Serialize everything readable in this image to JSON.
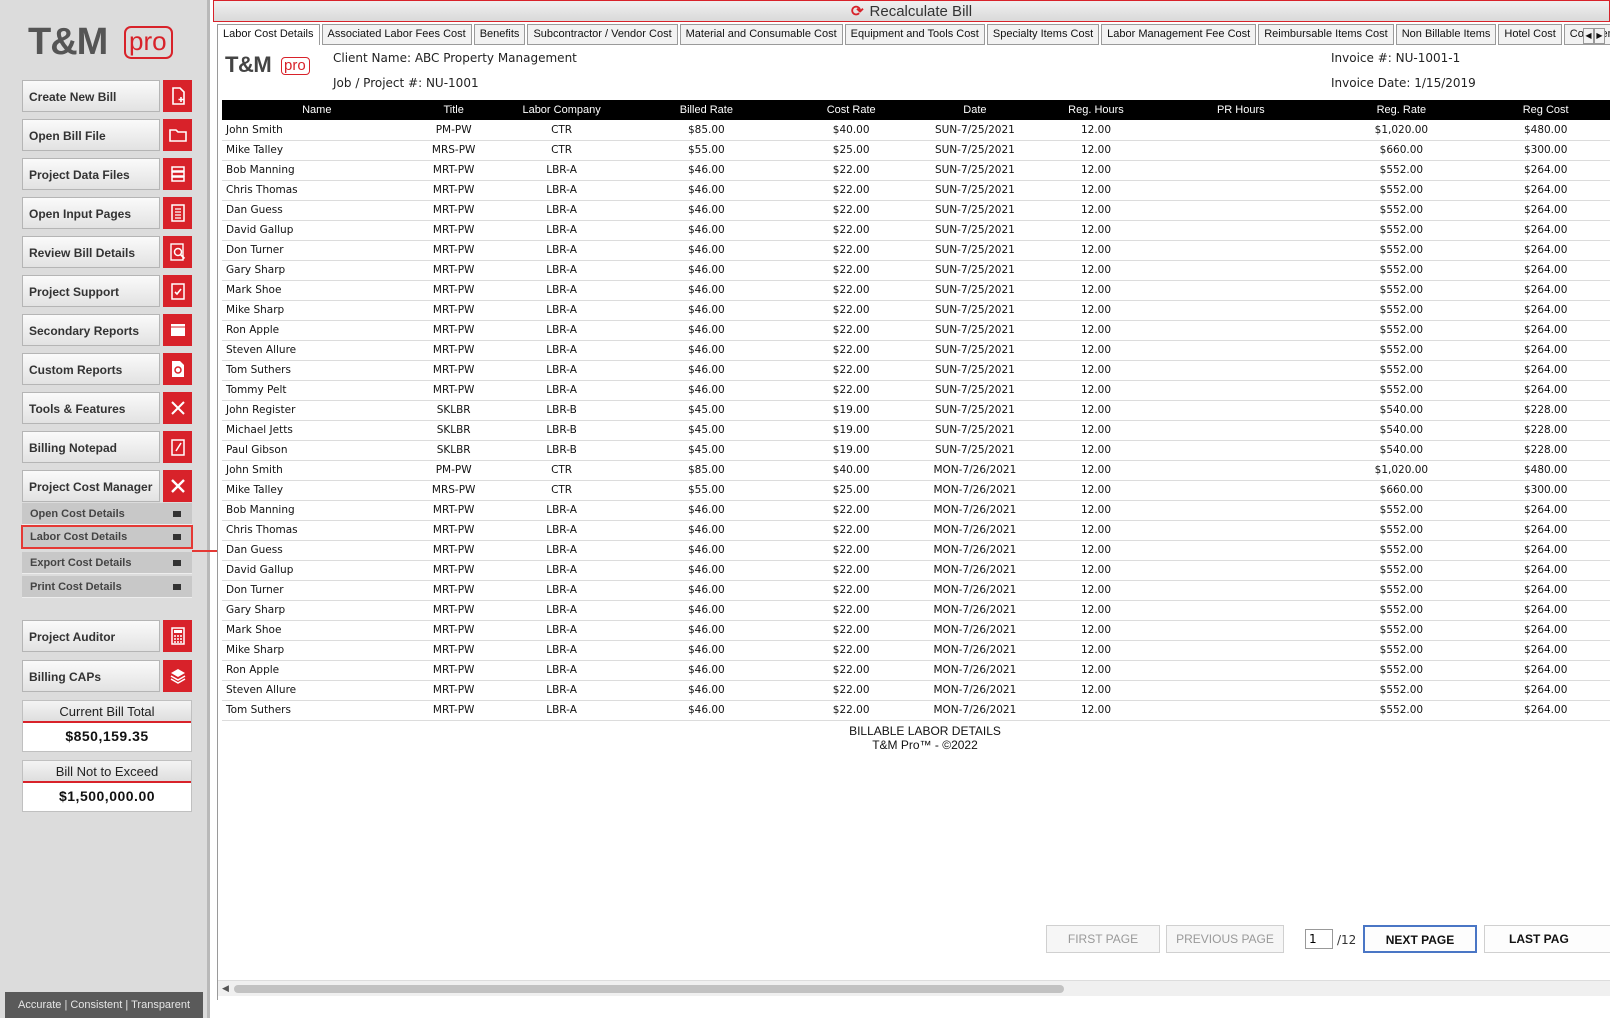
{
  "app": {
    "logo_main": "T&M",
    "logo_sub": "pro",
    "tagline": "Accurate | Consistent | Transparent"
  },
  "sidebar": {
    "buttons": [
      {
        "label": "Create New Bill",
        "icon": "new-file-icon"
      },
      {
        "label": "Open Bill File",
        "icon": "folder-icon"
      },
      {
        "label": "Project Data Files",
        "icon": "list-icon"
      },
      {
        "label": "Open Input Pages",
        "icon": "pages-icon"
      },
      {
        "label": "Review Bill Details",
        "icon": "magnifier-icon"
      },
      {
        "label": "Project Support",
        "icon": "checklist-icon"
      },
      {
        "label": "Secondary Reports",
        "icon": "report-icon"
      },
      {
        "label": "Custom Reports",
        "icon": "gear-doc-icon"
      },
      {
        "label": "Tools & Features",
        "icon": "tools-icon"
      },
      {
        "label": "Billing Notepad",
        "icon": "notepad-icon"
      },
      {
        "label": "Project Cost Manager",
        "icon": "close-icon"
      }
    ],
    "sub_items": [
      {
        "label": "Open Cost Details"
      },
      {
        "label": "Labor Cost Details"
      },
      {
        "label": "Export Cost Details"
      },
      {
        "label": "Print Cost Details"
      }
    ],
    "bottom_buttons": [
      {
        "label": "Project Auditor",
        "icon": "calculator-icon"
      },
      {
        "label": "Billing CAPs",
        "icon": "layers-icon"
      }
    ],
    "current_bill_total": {
      "label": "Current Bill Total",
      "value": "$850,159.35"
    },
    "bill_not_to_exceed": {
      "label": "Bill Not to Exceed",
      "value": "$1,500,000.00"
    }
  },
  "toolbar": {
    "recalculate_label": "Recalculate Bill"
  },
  "tabs": [
    "Labor Cost Details",
    "Associated Labor Fees Cost",
    "Benefits",
    "Subcontractor / Vendor Cost",
    "Material and Consumable Cost",
    "Equipment and Tools Cost",
    "Specialty Items Cost",
    "Labor Management Fee Cost",
    "Reimbursable Items Cost",
    "Non Billable Items",
    "Hotel Cost",
    "Cost Item F"
  ],
  "invoice": {
    "client_name": "Client Name: ABC Property Management",
    "job_project": "Job / Project #: NU-1001",
    "invoice_number": "Invoice #: NU-1001-1",
    "invoice_date": "Invoice Date: 1/15/2019"
  },
  "table": {
    "columns": [
      "Name",
      "Title",
      "Labor Company",
      "Billed Rate",
      "Cost Rate",
      "Date",
      "Reg. Hours",
      "PR Hours",
      "Reg. Rate",
      "Reg Cost"
    ],
    "rows": [
      [
        "John Smith",
        "PM-PW",
        "CTR",
        "$85.00",
        "$40.00",
        "SUN-7/25/2021",
        "12.00",
        "",
        "$1,020.00",
        "$480.00"
      ],
      [
        "Mike Talley",
        "MRS-PW",
        "CTR",
        "$55.00",
        "$25.00",
        "SUN-7/25/2021",
        "12.00",
        "",
        "$660.00",
        "$300.00"
      ],
      [
        "Bob Manning",
        "MRT-PW",
        "LBR-A",
        "$46.00",
        "$22.00",
        "SUN-7/25/2021",
        "12.00",
        "",
        "$552.00",
        "$264.00"
      ],
      [
        "Chris Thomas",
        "MRT-PW",
        "LBR-A",
        "$46.00",
        "$22.00",
        "SUN-7/25/2021",
        "12.00",
        "",
        "$552.00",
        "$264.00"
      ],
      [
        "Dan Guess",
        "MRT-PW",
        "LBR-A",
        "$46.00",
        "$22.00",
        "SUN-7/25/2021",
        "12.00",
        "",
        "$552.00",
        "$264.00"
      ],
      [
        "David Gallup",
        "MRT-PW",
        "LBR-A",
        "$46.00",
        "$22.00",
        "SUN-7/25/2021",
        "12.00",
        "",
        "$552.00",
        "$264.00"
      ],
      [
        "Don Turner",
        "MRT-PW",
        "LBR-A",
        "$46.00",
        "$22.00",
        "SUN-7/25/2021",
        "12.00",
        "",
        "$552.00",
        "$264.00"
      ],
      [
        "Gary Sharp",
        "MRT-PW",
        "LBR-A",
        "$46.00",
        "$22.00",
        "SUN-7/25/2021",
        "12.00",
        "",
        "$552.00",
        "$264.00"
      ],
      [
        "Mark Shoe",
        "MRT-PW",
        "LBR-A",
        "$46.00",
        "$22.00",
        "SUN-7/25/2021",
        "12.00",
        "",
        "$552.00",
        "$264.00"
      ],
      [
        "Mike Sharp",
        "MRT-PW",
        "LBR-A",
        "$46.00",
        "$22.00",
        "SUN-7/25/2021",
        "12.00",
        "",
        "$552.00",
        "$264.00"
      ],
      [
        "Ron Apple",
        "MRT-PW",
        "LBR-A",
        "$46.00",
        "$22.00",
        "SUN-7/25/2021",
        "12.00",
        "",
        "$552.00",
        "$264.00"
      ],
      [
        "Steven Allure",
        "MRT-PW",
        "LBR-A",
        "$46.00",
        "$22.00",
        "SUN-7/25/2021",
        "12.00",
        "",
        "$552.00",
        "$264.00"
      ],
      [
        "Tom Suthers",
        "MRT-PW",
        "LBR-A",
        "$46.00",
        "$22.00",
        "SUN-7/25/2021",
        "12.00",
        "",
        "$552.00",
        "$264.00"
      ],
      [
        "Tommy Pelt",
        "MRT-PW",
        "LBR-A",
        "$46.00",
        "$22.00",
        "SUN-7/25/2021",
        "12.00",
        "",
        "$552.00",
        "$264.00"
      ],
      [
        "John Register",
        "SKLBR",
        "LBR-B",
        "$45.00",
        "$19.00",
        "SUN-7/25/2021",
        "12.00",
        "",
        "$540.00",
        "$228.00"
      ],
      [
        "Michael Jetts",
        "SKLBR",
        "LBR-B",
        "$45.00",
        "$19.00",
        "SUN-7/25/2021",
        "12.00",
        "",
        "$540.00",
        "$228.00"
      ],
      [
        "Paul Gibson",
        "SKLBR",
        "LBR-B",
        "$45.00",
        "$19.00",
        "SUN-7/25/2021",
        "12.00",
        "",
        "$540.00",
        "$228.00"
      ],
      [
        "John Smith",
        "PM-PW",
        "CTR",
        "$85.00",
        "$40.00",
        "MON-7/26/2021",
        "12.00",
        "",
        "$1,020.00",
        "$480.00"
      ],
      [
        "Mike Talley",
        "MRS-PW",
        "CTR",
        "$55.00",
        "$25.00",
        "MON-7/26/2021",
        "12.00",
        "",
        "$660.00",
        "$300.00"
      ],
      [
        "Bob Manning",
        "MRT-PW",
        "LBR-A",
        "$46.00",
        "$22.00",
        "MON-7/26/2021",
        "12.00",
        "",
        "$552.00",
        "$264.00"
      ],
      [
        "Chris Thomas",
        "MRT-PW",
        "LBR-A",
        "$46.00",
        "$22.00",
        "MON-7/26/2021",
        "12.00",
        "",
        "$552.00",
        "$264.00"
      ],
      [
        "Dan Guess",
        "MRT-PW",
        "LBR-A",
        "$46.00",
        "$22.00",
        "MON-7/26/2021",
        "12.00",
        "",
        "$552.00",
        "$264.00"
      ],
      [
        "David Gallup",
        "MRT-PW",
        "LBR-A",
        "$46.00",
        "$22.00",
        "MON-7/26/2021",
        "12.00",
        "",
        "$552.00",
        "$264.00"
      ],
      [
        "Don Turner",
        "MRT-PW",
        "LBR-A",
        "$46.00",
        "$22.00",
        "MON-7/26/2021",
        "12.00",
        "",
        "$552.00",
        "$264.00"
      ],
      [
        "Gary Sharp",
        "MRT-PW",
        "LBR-A",
        "$46.00",
        "$22.00",
        "MON-7/26/2021",
        "12.00",
        "",
        "$552.00",
        "$264.00"
      ],
      [
        "Mark Shoe",
        "MRT-PW",
        "LBR-A",
        "$46.00",
        "$22.00",
        "MON-7/26/2021",
        "12.00",
        "",
        "$552.00",
        "$264.00"
      ],
      [
        "Mike Sharp",
        "MRT-PW",
        "LBR-A",
        "$46.00",
        "$22.00",
        "MON-7/26/2021",
        "12.00",
        "",
        "$552.00",
        "$264.00"
      ],
      [
        "Ron Apple",
        "MRT-PW",
        "LBR-A",
        "$46.00",
        "$22.00",
        "MON-7/26/2021",
        "12.00",
        "",
        "$552.00",
        "$264.00"
      ],
      [
        "Steven Allure",
        "MRT-PW",
        "LBR-A",
        "$46.00",
        "$22.00",
        "MON-7/26/2021",
        "12.00",
        "",
        "$552.00",
        "$264.00"
      ],
      [
        "Tom Suthers",
        "MRT-PW",
        "LBR-A",
        "$46.00",
        "$22.00",
        "MON-7/26/2021",
        "12.00",
        "",
        "$552.00",
        "$264.00"
      ]
    ]
  },
  "report_footer": {
    "line1": "BILLABLE LABOR DETAILS",
    "line2": "T&M Pro™ - ©2022"
  },
  "pagination": {
    "first": "FIRST PAGE",
    "previous": "PREVIOUS PAGE",
    "current_page": "1",
    "total": "/12",
    "next": "NEXT PAGE",
    "last": "LAST PAG"
  },
  "colors": {
    "accent": "#d8222a",
    "header_bg": "#000000",
    "sidebar_bg": "#dcdcdc"
  }
}
